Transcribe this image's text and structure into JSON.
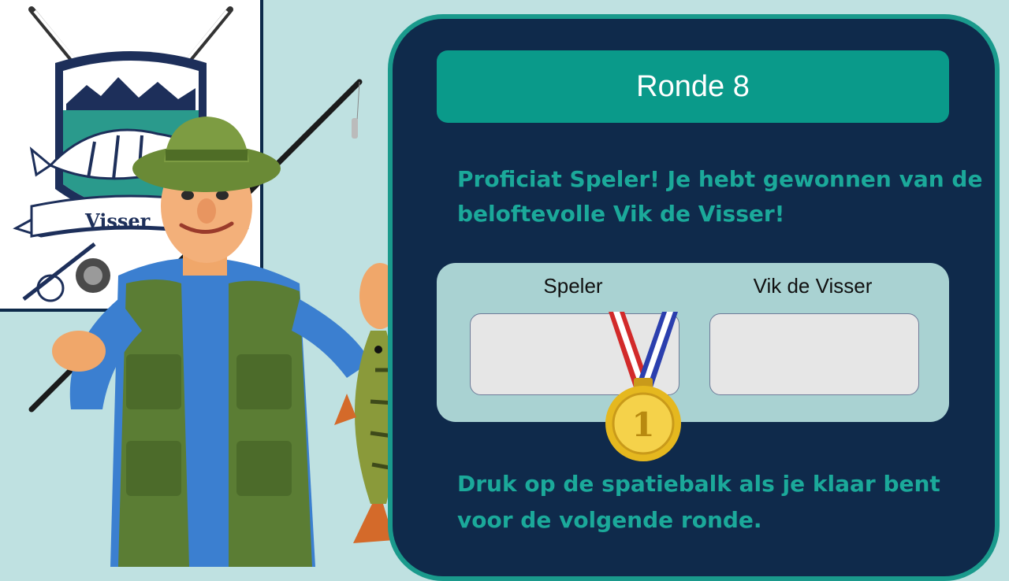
{
  "logo": {
    "text": "Visser",
    "icon": "fishing-club-logo"
  },
  "round": {
    "title": "Ronde 8"
  },
  "message": "Proficiat Speler! Je hebt gewonnen van de beloftevolle Vik de Visser!",
  "scoreboard": {
    "players": [
      {
        "name": "Speler",
        "score": ""
      },
      {
        "name": "Vik de Visser",
        "score": ""
      }
    ],
    "winner_medal": {
      "icon": "gold-medal-icon",
      "rank": "1"
    }
  },
  "footer": "Druk op de spatiebalk als je klaar bent voor de volgende ronde.",
  "colors": {
    "background": "#bfe1e1",
    "panel": "#0f2a4b",
    "accent": "#0a9a8a",
    "text_accent": "#1ba99a"
  }
}
